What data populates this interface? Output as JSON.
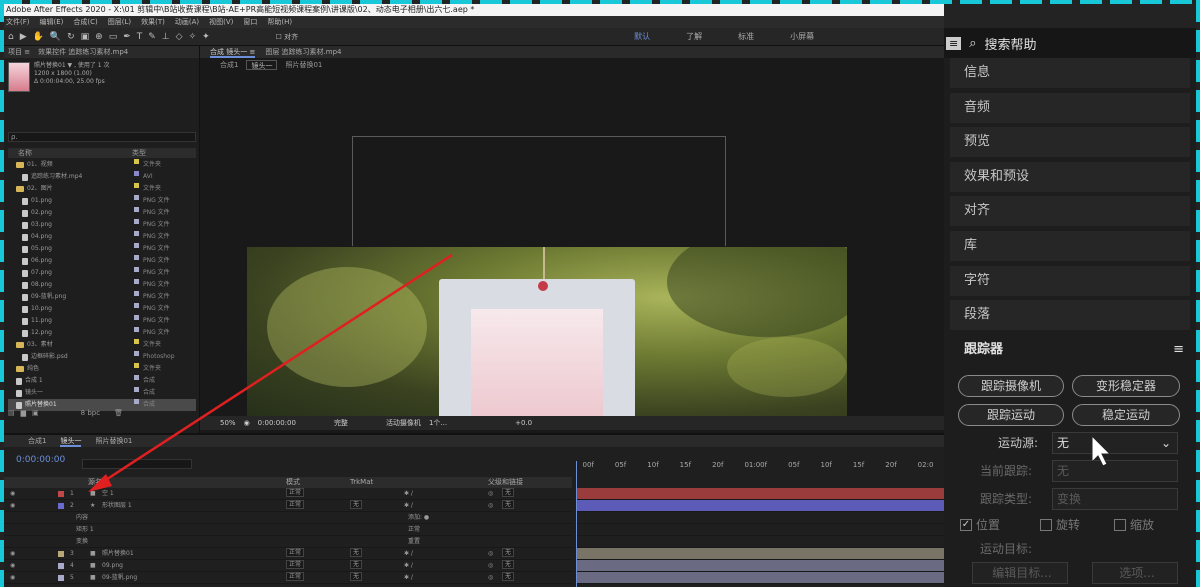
{
  "window_title": "Adobe After Effects 2020 - X:\\01 剪辑中\\B站收费课程\\B站-AE+PR高能短视频课程案例\\讲课版\\02、动态电子相册\\出六七.aep *",
  "menu": [
    "文件(F)",
    "编辑(E)",
    "合成(C)",
    "图层(L)",
    "效果(T)",
    "动画(A)",
    "视图(V)",
    "窗口",
    "帮助(H)"
  ],
  "toolbar": {
    "align_label": "对齐",
    "workspaces": [
      "默认",
      "了解",
      "标准",
      "小屏幕"
    ]
  },
  "project": {
    "tabs": [
      "项目 ≡",
      "效果控件 追踪练习素材.mp4"
    ],
    "selected_name": "照片替换01 ▼ , 使用了 1 次",
    "selected_info": "1200 x 1800 (1.00)\nΔ 0:00:04:00, 25.00 fps",
    "search_placeholder": "ρ.",
    "col_name": "名称",
    "col_type": "类型",
    "items": [
      {
        "name": "01、视频",
        "type": "文件夹",
        "color": "#d6c54a",
        "icon": "folder-icon"
      },
      {
        "name": "追踪练习素材.mp4",
        "type": "AVI",
        "color": "#8a88c9",
        "icon": "footage-icon"
      },
      {
        "name": "02、图片",
        "type": "文件夹",
        "color": "#d6c54a",
        "icon": "folder-icon"
      },
      {
        "name": "01.png",
        "type": "PNG 文件",
        "color": "#a9a9c9",
        "icon": "image-icon"
      },
      {
        "name": "02.png",
        "type": "PNG 文件",
        "color": "#a9a9c9",
        "icon": "image-icon"
      },
      {
        "name": "03.png",
        "type": "PNG 文件",
        "color": "#a9a9c9",
        "icon": "image-icon"
      },
      {
        "name": "04.png",
        "type": "PNG 文件",
        "color": "#a9a9c9",
        "icon": "image-icon"
      },
      {
        "name": "05.png",
        "type": "PNG 文件",
        "color": "#a9a9c9",
        "icon": "image-icon"
      },
      {
        "name": "06.png",
        "type": "PNG 文件",
        "color": "#a9a9c9",
        "icon": "image-icon"
      },
      {
        "name": "07.png",
        "type": "PNG 文件",
        "color": "#a9a9c9",
        "icon": "image-icon"
      },
      {
        "name": "08.png",
        "type": "PNG 文件",
        "color": "#a9a9c9",
        "icon": "image-icon"
      },
      {
        "name": "09-蓝帆.png",
        "type": "PNG 文件",
        "color": "#a9a9c9",
        "icon": "image-icon"
      },
      {
        "name": "10.png",
        "type": "PNG 文件",
        "color": "#a9a9c9",
        "icon": "image-icon"
      },
      {
        "name": "11.png",
        "type": "PNG 文件",
        "color": "#a9a9c9",
        "icon": "image-icon"
      },
      {
        "name": "12.png",
        "type": "PNG 文件",
        "color": "#a9a9c9",
        "icon": "image-icon"
      },
      {
        "name": "03、素材",
        "type": "文件夹",
        "color": "#d6c54a",
        "icon": "folder-icon"
      },
      {
        "name": "边框碎影.psd",
        "type": "Photoshop",
        "color": "#a9a9c9",
        "icon": "image-icon"
      },
      {
        "name": "纯色",
        "type": "文件夹",
        "color": "#d6c54a",
        "icon": "folder-icon"
      },
      {
        "name": "合成 1",
        "type": "合成",
        "color": "#a9a9c9",
        "icon": "comp-icon"
      },
      {
        "name": "镜头一",
        "type": "合成",
        "color": "#a9a9c9",
        "icon": "comp-icon"
      },
      {
        "name": "照片替换01",
        "type": "合成",
        "color": "#a9a9c9",
        "icon": "comp-icon",
        "selected": true
      }
    ],
    "bpc": "8 bpc"
  },
  "composition": {
    "tabs": [
      "合成 镜头一 ≡",
      "图层 追踪练习素材.mp4"
    ],
    "breadcrumbs": [
      "合成1",
      "镜头一",
      "照片替换01"
    ],
    "viewer": {
      "zoom": "50%",
      "time": "0:00:00:00",
      "quality": "完整",
      "camera": "活动摄像机",
      "views": "1个...",
      "exposure": "+0.0"
    }
  },
  "timeline": {
    "tabs": [
      "合成1",
      "镜头一",
      "照片替换01"
    ],
    "timecode": "0:00:00:00",
    "columns": {
      "name": "源名称",
      "mode": "模式",
      "trkmat": "TrkMat",
      "parent": "父级和链接"
    },
    "ruler": [
      "00f",
      "05f",
      "10f",
      "15f",
      "20f",
      "01:00f",
      "05f",
      "10f",
      "15f",
      "20f",
      "02:0"
    ],
    "layers": [
      {
        "num": "1",
        "name": "空 1",
        "color": "#c04848",
        "mode": "正常",
        "trkmat": "",
        "parent": "无",
        "bar": "#9a3c3c",
        "selected": false
      },
      {
        "num": "2",
        "name": "形状图层 1",
        "color": "#6a6ad0",
        "mode": "正常",
        "trkmat": "无",
        "parent": "无",
        "bar": "#5c5cb8",
        "selected": false
      },
      {
        "num": "",
        "name": "内容",
        "sub": true,
        "extra": "添加: ●"
      },
      {
        "num": "",
        "name": "矩形 1",
        "sub": true,
        "extra": "正常"
      },
      {
        "num": "",
        "name": "变换",
        "sub": true,
        "extra": "重置"
      },
      {
        "num": "3",
        "name": "照片替换01",
        "color": "#b8a878",
        "mode": "正常",
        "trkmat": "无",
        "parent": "无",
        "bar": "#7a7466",
        "selected": false
      },
      {
        "num": "4",
        "name": "09.png",
        "color": "#a9a9c9",
        "mode": "正常",
        "trkmat": "无",
        "parent": "无",
        "bar": "#6a6a82",
        "selected": false
      },
      {
        "num": "5",
        "name": "09-蓝帆.png",
        "color": "#a9a9c9",
        "mode": "正常",
        "trkmat": "无",
        "parent": "无",
        "bar": "#6a6a82",
        "selected": false
      }
    ]
  },
  "right_panel": {
    "search_label": "搜索帮助",
    "items": [
      "信息",
      "音频",
      "预览",
      "效果和预设",
      "对齐",
      "库",
      "字符",
      "段落"
    ],
    "tracker": {
      "title": "跟踪器",
      "buttons": [
        "跟踪摄像机",
        "变形稳定器",
        "跟踪运动",
        "稳定运动"
      ],
      "motion_source_label": "运动源:",
      "motion_source_value": "无",
      "current_track_label": "当前跟踪:",
      "current_track_value": "无",
      "track_type_label": "跟踪类型:",
      "track_type_value": "变换",
      "checks": [
        {
          "label": "位置",
          "checked": true
        },
        {
          "label": "旋转",
          "checked": false
        },
        {
          "label": "缩放",
          "checked": false
        }
      ],
      "motion_target_label": "运动目标:",
      "edit_target": "编辑目标...",
      "options": "选项..."
    }
  },
  "annotation_color": "#e02020"
}
